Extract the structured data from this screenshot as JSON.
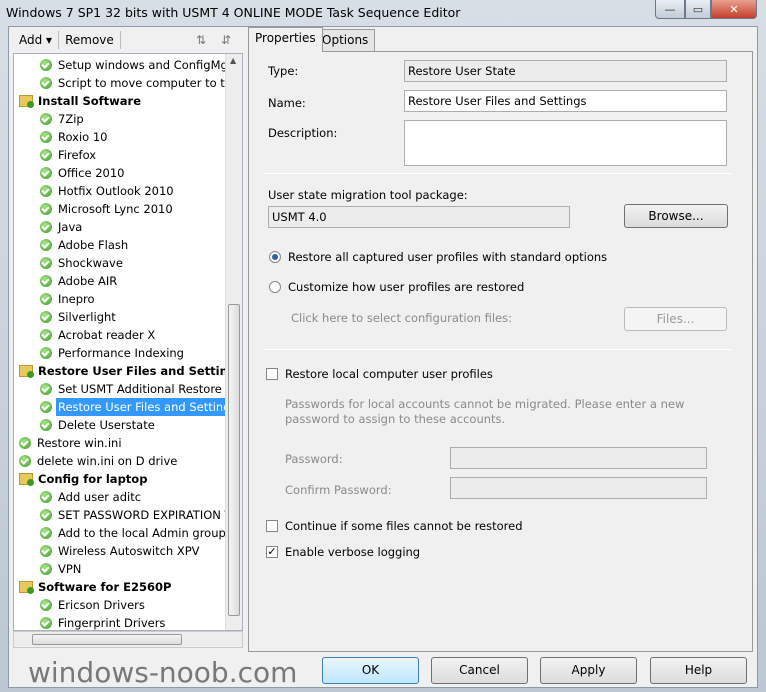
{
  "window": {
    "title": "Windows 7 SP1 32 bits with USMT 4 ONLINE MODE Task Sequence Editor",
    "minimize": "—",
    "maximize": "▭",
    "close": "✕"
  },
  "toolbar": {
    "add": "Add",
    "remove": "Remove"
  },
  "tree": [
    {
      "label": "Setup windows and ConfigMgr",
      "type": "step",
      "level": 2
    },
    {
      "label": "Script to move computer to the",
      "type": "step",
      "level": 2
    },
    {
      "label": "Install Software",
      "type": "group",
      "level": 1
    },
    {
      "label": "7Zip",
      "type": "step",
      "level": 2
    },
    {
      "label": "Roxio 10",
      "type": "step",
      "level": 2
    },
    {
      "label": "Firefox",
      "type": "step",
      "level": 2
    },
    {
      "label": "Office 2010",
      "type": "step",
      "level": 2
    },
    {
      "label": "Hotfix Outlook 2010",
      "type": "step",
      "level": 2
    },
    {
      "label": "Microsoft Lync 2010",
      "type": "step",
      "level": 2
    },
    {
      "label": "Java",
      "type": "step",
      "level": 2
    },
    {
      "label": "Adobe Flash",
      "type": "step",
      "level": 2
    },
    {
      "label": "Shockwave",
      "type": "step",
      "level": 2
    },
    {
      "label": "Adobe AIR",
      "type": "step",
      "level": 2
    },
    {
      "label": "Inepro",
      "type": "step",
      "level": 2
    },
    {
      "label": "Silverlight",
      "type": "step",
      "level": 2
    },
    {
      "label": "Acrobat reader X",
      "type": "step",
      "level": 2
    },
    {
      "label": "Performance Indexing",
      "type": "step",
      "level": 2
    },
    {
      "label": "Restore User Files and Settings",
      "type": "group",
      "level": 1
    },
    {
      "label": "Set USMT Additional Restore O",
      "type": "step",
      "level": 2
    },
    {
      "label": "Restore User Files and Settings",
      "type": "step",
      "level": 2,
      "selected": true
    },
    {
      "label": "Delete Userstate",
      "type": "step",
      "level": 2
    },
    {
      "label": "Restore win.ini",
      "type": "step",
      "level": 1
    },
    {
      "label": "delete win.ini on D drive",
      "type": "step",
      "level": 1
    },
    {
      "label": "Config for laptop",
      "type": "group",
      "level": 1
    },
    {
      "label": "Add user aditc",
      "type": "step",
      "level": 2
    },
    {
      "label": "SET PASSWORD EXPIRATION T",
      "type": "step",
      "level": 2
    },
    {
      "label": "Add to the local Admin group",
      "type": "step",
      "level": 2
    },
    {
      "label": "Wireless Autoswitch XPV",
      "type": "step",
      "level": 2
    },
    {
      "label": "VPN",
      "type": "step",
      "level": 2
    },
    {
      "label": "Software for E2560P",
      "type": "group",
      "level": 1
    },
    {
      "label": "Ericson Drivers",
      "type": "step",
      "level": 2
    },
    {
      "label": "Fingerprint Drivers",
      "type": "step",
      "level": 2
    }
  ],
  "tabs": {
    "properties": "Properties",
    "options": "Options"
  },
  "props": {
    "type_label": "Type:",
    "type_value": "Restore User State",
    "name_label": "Name:",
    "name_value": "Restore User Files and Settings",
    "description_label": "Description:",
    "description_value": "",
    "package_label": "User state migration tool package:",
    "package_value": "USMT 4.0",
    "browse": "Browse...",
    "radio_all": "Restore all captured user profiles with standard options",
    "radio_custom": "Customize how user profiles are restored",
    "config_hint": "Click here to select configuration files:",
    "files": "Files...",
    "restore_local": "Restore local computer user profiles",
    "password_note": "Passwords for local accounts cannot be migrated. Please enter a new password to assign to these accounts.",
    "password_label": "Password:",
    "confirm_label": "Confirm Password:",
    "continue_label": "Continue if some files cannot be restored",
    "verbose_label": "Enable verbose logging",
    "verbose_checked": true
  },
  "buttons": {
    "ok": "OK",
    "cancel": "Cancel",
    "apply": "Apply",
    "help": "Help"
  },
  "watermark": "windows-noob.com"
}
